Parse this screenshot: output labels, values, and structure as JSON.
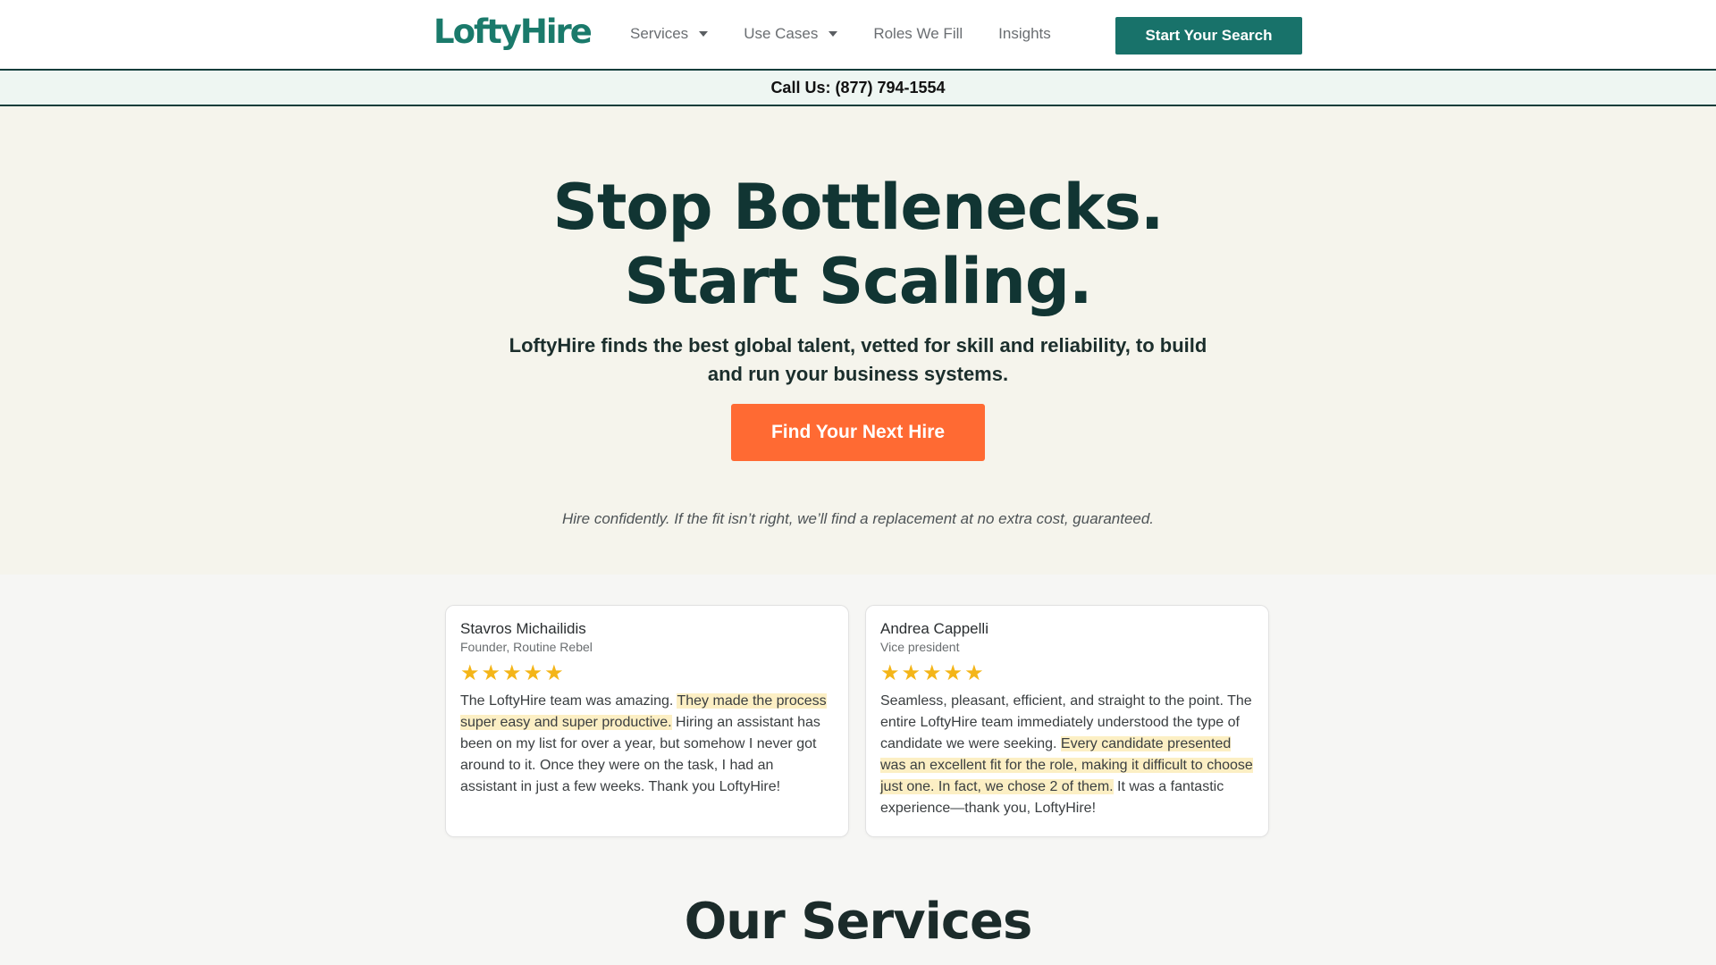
{
  "header": {
    "logo": "LoftyHire",
    "nav": [
      {
        "label": "Services",
        "dropdown": true
      },
      {
        "label": "Use Cases",
        "dropdown": true
      },
      {
        "label": "Roles We Fill",
        "dropdown": false
      },
      {
        "label": "Insights",
        "dropdown": false
      }
    ],
    "cta_label": "Start Your Search"
  },
  "callbar": {
    "text": "Call Us: (877) 794-1554"
  },
  "hero": {
    "headline_line1": "Stop Bottlenecks.",
    "headline_line2": "Start Scaling.",
    "subheadline": "LoftyHire finds the best global talent, vetted for skill and reliability, to build and run your business systems.",
    "cta_label": "Find Your Next Hire",
    "guarantee": "Hire confidently. If the fit isn’t right, we’ll find a replacement at no extra cost, guaranteed."
  },
  "testimonials": [
    {
      "name": "Stavros Michailidis",
      "role": "Founder, Routine Rebel",
      "rating": 5,
      "text_before": "The LoftyHire team was amazing. ",
      "text_highlight": "They made the process super easy and super productive.",
      "text_after": " Hiring an assistant has been on my list for over a year, but somehow I never got around to it. Once they were on the task, I had an assistant in just a few weeks. Thank you LoftyHire!"
    },
    {
      "name": "Andrea Cappelli",
      "role": "Vice president",
      "rating": 5,
      "text_before": "Seamless, pleasant, efficient, and straight to the point. The entire LoftyHire team immediately understood the type of candidate we were seeking. ",
      "text_highlight": "Every candidate presented was an excellent fit for the role, making it difficult to choose just one. In fact, we chose 2 of them.",
      "text_after": " It was a fantastic experience—thank you, LoftyHire!"
    }
  ],
  "services": {
    "title": "Our Services"
  },
  "colors": {
    "brand_teal": "#18726a",
    "accent_orange": "#ff6a33",
    "star": "#f4b518",
    "highlight": "#fcefc4"
  },
  "icons": {
    "dropdown": "chevron-down-icon",
    "rating": "star-icon"
  }
}
